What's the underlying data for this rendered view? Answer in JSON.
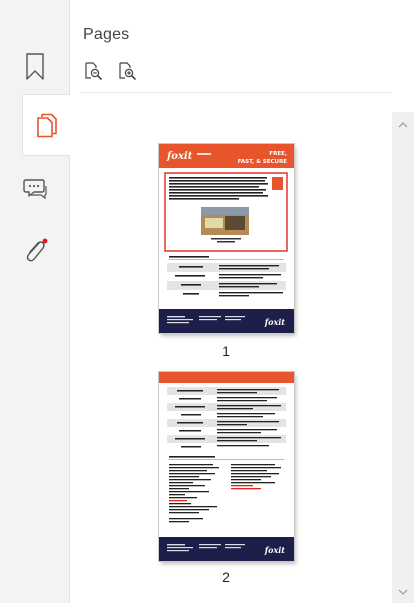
{
  "panel": {
    "title": "Pages"
  },
  "rail": {
    "items": [
      {
        "name": "bookmark",
        "icon": "bookmark-icon",
        "active": false
      },
      {
        "name": "pages",
        "icon": "pages-icon",
        "active": true
      },
      {
        "name": "comments",
        "icon": "comment-icon",
        "active": false
      },
      {
        "name": "attachments",
        "icon": "paperclip-icon",
        "active": false,
        "notification": true
      }
    ]
  },
  "toolbar": [
    {
      "icon": "zoom-out-page-icon"
    },
    {
      "icon": "zoom-in-page-icon"
    }
  ],
  "thumbnails": [
    {
      "page": "1",
      "thumb_text": [
        "foxit",
        "FREE,",
        "FAST, & SECURE"
      ]
    },
    {
      "page": "2",
      "thumb_text": [
        "foxit"
      ]
    }
  ],
  "colors": {
    "accent": "#e8542c",
    "navy": "#1d1e4a",
    "highlight": "#e0281e",
    "rail_bg": "#f3f3f3",
    "notification": "#e81123"
  }
}
